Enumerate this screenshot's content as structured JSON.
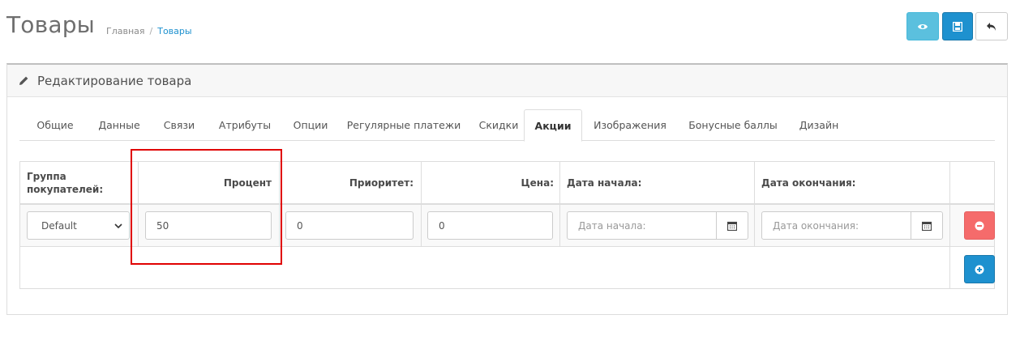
{
  "header": {
    "title": "Товары",
    "breadcrumb": {
      "home": "Главная",
      "separator": "/",
      "current": "Товары"
    }
  },
  "toolbar": {
    "view_icon": "eye-icon",
    "save_icon": "save-icon",
    "back_icon": "reply-icon"
  },
  "panel": {
    "icon": "pencil-icon",
    "title": "Редактирование товара"
  },
  "tabs": [
    {
      "label": "Общие"
    },
    {
      "label": "Данные"
    },
    {
      "label": "Связи"
    },
    {
      "label": "Атрибуты"
    },
    {
      "label": "Опции"
    },
    {
      "label": "Регулярные платежи"
    },
    {
      "label": "Скидки"
    },
    {
      "label": "Акции",
      "active": true
    },
    {
      "label": "Изображения"
    },
    {
      "label": "Бонусные баллы"
    },
    {
      "label": "Дизайн"
    }
  ],
  "table": {
    "headers": {
      "customer_group_line1": "Группа",
      "customer_group_line2": "покупателей:",
      "percent": "Процент",
      "priority": "Приоритет:",
      "price": "Цена:",
      "date_start": "Дата начала:",
      "date_end": "Дата окончания:"
    },
    "row": {
      "customer_group": "Default",
      "percent": "50",
      "priority": "0",
      "price": "0",
      "date_start_placeholder": "Дата начала:",
      "date_end_placeholder": "Дата окончания:"
    }
  },
  "colors": {
    "primary": "#1e91cf",
    "info": "#5bc0de",
    "danger": "#f56b6b",
    "highlight": "#e00000"
  }
}
